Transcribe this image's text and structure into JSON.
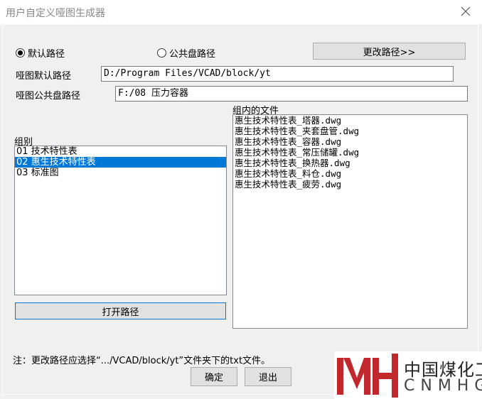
{
  "window": {
    "title": "用户自定义哑图生成器"
  },
  "path_options": {
    "default_label": "默认路径",
    "public_label": "公共盘路径",
    "selected": "default",
    "change_path_label": "更改路径>>"
  },
  "paths": {
    "default_label": "哑图默认路径",
    "default_value": "D:/Program Files/VCAD/block/yt",
    "public_label": "哑图公共盘路径",
    "public_value": "F:/08 压力容器"
  },
  "groups": {
    "label": "组别",
    "items": [
      "01 技术特性表",
      "02 惠生技术特性表",
      "03 标准图"
    ],
    "selected_index": 1
  },
  "open_path_label": "打开路径",
  "files": {
    "label": "组内的文件",
    "items": [
      "惠生技术特性表_塔器.dwg",
      "惠生技术特性表_夹套盘管.dwg",
      "惠生技术特性表_容器.dwg",
      "惠生技术特性表_常压储罐.dwg",
      "惠生技术特性表_换热器.dwg",
      "惠生技术特性表_料仓.dwg",
      "惠生技术特性表_疲劳.dwg"
    ]
  },
  "note": "注：更改路径应选择“.../VCAD/block/yt”文件夹下的txt文件。",
  "buttons": {
    "ok": "确定",
    "exit": "退出"
  },
  "watermark": {
    "logo_mark": "MH",
    "cn_text": "中国煤化工",
    "en_text": "CNMHG",
    "brand_color": "#c1272d"
  }
}
